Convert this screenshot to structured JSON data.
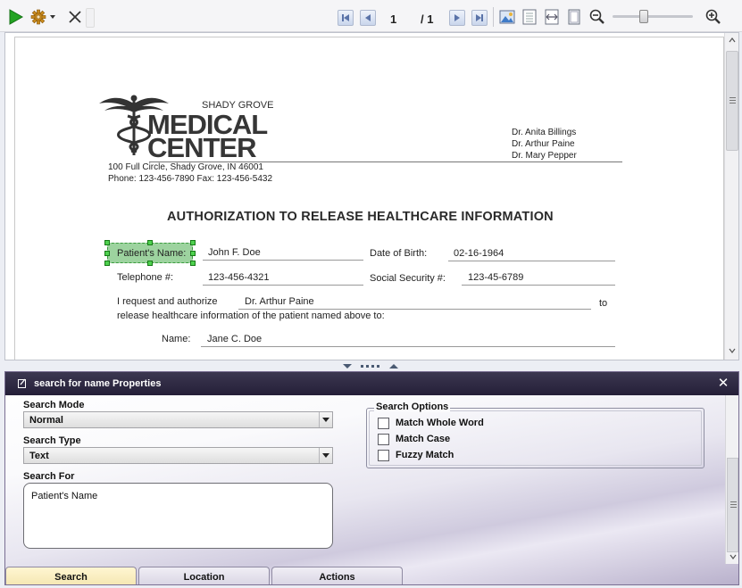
{
  "toolbar": {
    "play_icon": "play-icon",
    "settings_icon": "gear-icon",
    "close_icon": "close-icon",
    "current_page": "1",
    "total_pages": "/ 1",
    "zoom_level_fraction": 0.38
  },
  "document": {
    "logo_subtitle": "SHADY GROVE",
    "logo_line1": "MEDICAL",
    "logo_line2": "CENTER",
    "doctors": [
      "Dr. Anita Billings",
      "Dr. Arthur Paine",
      "Dr. Mary Pepper"
    ],
    "address_line1": "100 Full Circle, Shady Grove, IN 46001",
    "address_line2": "Phone: 123-456-7890  Fax: 123-456-5432",
    "title": "AUTHORIZATION TO RELEASE HEALTHCARE INFORMATION",
    "patient_name_label": "Patient's Name:",
    "patient_name_value": "John F. Doe",
    "dob_label": "Date of Birth:",
    "dob_value": "02-16-1964",
    "telephone_label": "Telephone #:",
    "telephone_value": "123-456-4321",
    "ssn_label": "Social Security #:",
    "ssn_value": "123-45-6789",
    "authorize_text": "I request and authorize",
    "authorize_value": "Dr. Arthur Paine",
    "authorize_to": "to",
    "release_text": "release healthcare information of the patient named above to:",
    "name_label": "Name:",
    "name_value": "Jane C. Doe"
  },
  "panel": {
    "title": "search for name Properties",
    "close_symbol": "✕",
    "search_mode_label": "Search Mode",
    "search_mode_value": "Normal",
    "search_type_label": "Search Type",
    "search_type_value": "Text",
    "search_for_label": "Search For",
    "search_for_value": "Patient's Name",
    "search_options_title": "Search Options",
    "options": [
      {
        "label": "Match Whole Word",
        "checked": false
      },
      {
        "label": "Match Case",
        "checked": false
      },
      {
        "label": "Fuzzy Match",
        "checked": false
      }
    ],
    "tabs": [
      {
        "label": "Search",
        "active": true
      },
      {
        "label": "Location",
        "active": false
      },
      {
        "label": "Actions",
        "active": false
      }
    ]
  },
  "colors": {
    "selection_fill": "#9dd39f",
    "selection_handle": "#4fd14f",
    "panel_header": "#2b2540",
    "active_tab": "#f7ebbd"
  }
}
